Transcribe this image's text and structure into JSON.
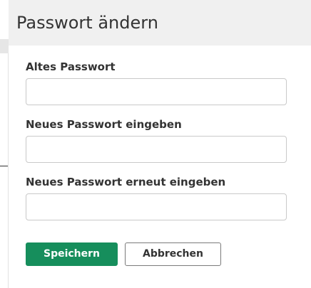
{
  "dialog": {
    "title": "Passwort ändern",
    "fields": [
      {
        "label": "Altes Passwort",
        "value": "",
        "placeholder": ""
      },
      {
        "label": "Neues Passwort eingeben",
        "value": "",
        "placeholder": ""
      },
      {
        "label": "Neues Passwort erneut eingeben",
        "value": "",
        "placeholder": ""
      }
    ],
    "buttons": {
      "save": "Speichern",
      "cancel": "Abbrechen"
    }
  },
  "colors": {
    "primary": "#168e5c",
    "header_background": "#f0f0f0",
    "text": "#333333",
    "input_border": "#c9c9c9"
  }
}
